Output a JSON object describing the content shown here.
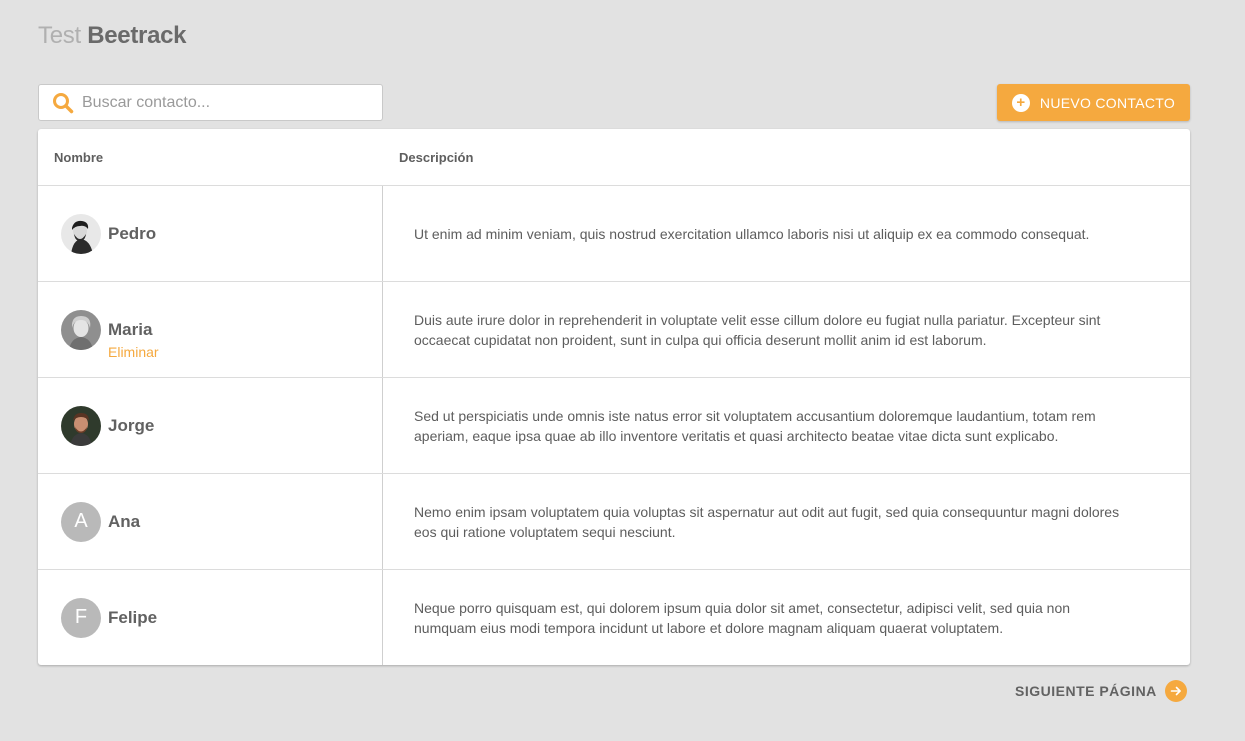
{
  "header": {
    "title_light": "Test",
    "title_bold": "Beetrack"
  },
  "search": {
    "placeholder": "Buscar contacto...",
    "value": "",
    "icon": "search-icon"
  },
  "toolbar": {
    "new_contact_label": "NUEVO CONTACTO",
    "new_contact_icon": "plus-circle-icon"
  },
  "table": {
    "columns": [
      "Nombre",
      "Descripción"
    ],
    "rows": [
      {
        "name": "Pedro",
        "avatar": "photo",
        "description": "Ut enim ad minim veniam, quis nostrud exercitation ullamco laboris nisi ut aliquip ex ea commodo consequat."
      },
      {
        "name": "Maria",
        "avatar": "photo",
        "delete_label": "Eliminar",
        "description": "Duis aute irure dolor in reprehenderit in voluptate velit esse cillum dolore eu fugiat nulla pariatur. Excepteur sint occaecat cupidatat non proident, sunt in culpa qui officia deserunt mollit anim id est laborum."
      },
      {
        "name": "Jorge",
        "avatar": "photo",
        "description": "Sed ut perspiciatis unde omnis iste natus error sit voluptatem accusantium doloremque laudantium, totam rem aperiam, eaque ipsa quae ab illo inventore veritatis et quasi architecto beatae vitae dicta sunt explicabo."
      },
      {
        "name": "Ana",
        "avatar_initial": "A",
        "description": "Nemo enim ipsam voluptatem quia voluptas sit aspernatur aut odit aut fugit, sed quia consequuntur magni dolores eos qui ratione voluptatem sequi nesciunt."
      },
      {
        "name": "Felipe",
        "avatar_initial": "F",
        "description": "Neque porro quisquam est, qui dolorem ipsum quia dolor sit amet, consectetur, adipisci velit, sed quia non numquam eius modi tempora incidunt ut labore et dolore magnam aliquam quaerat voluptatem."
      }
    ]
  },
  "pagination": {
    "next_label": "SIGUIENTE PÁGINA",
    "next_icon": "arrow-right-circle-icon"
  },
  "colors": {
    "accent": "#f5a93f",
    "background": "#e2e2e2",
    "avatar_placeholder": "#b9b9b9"
  }
}
